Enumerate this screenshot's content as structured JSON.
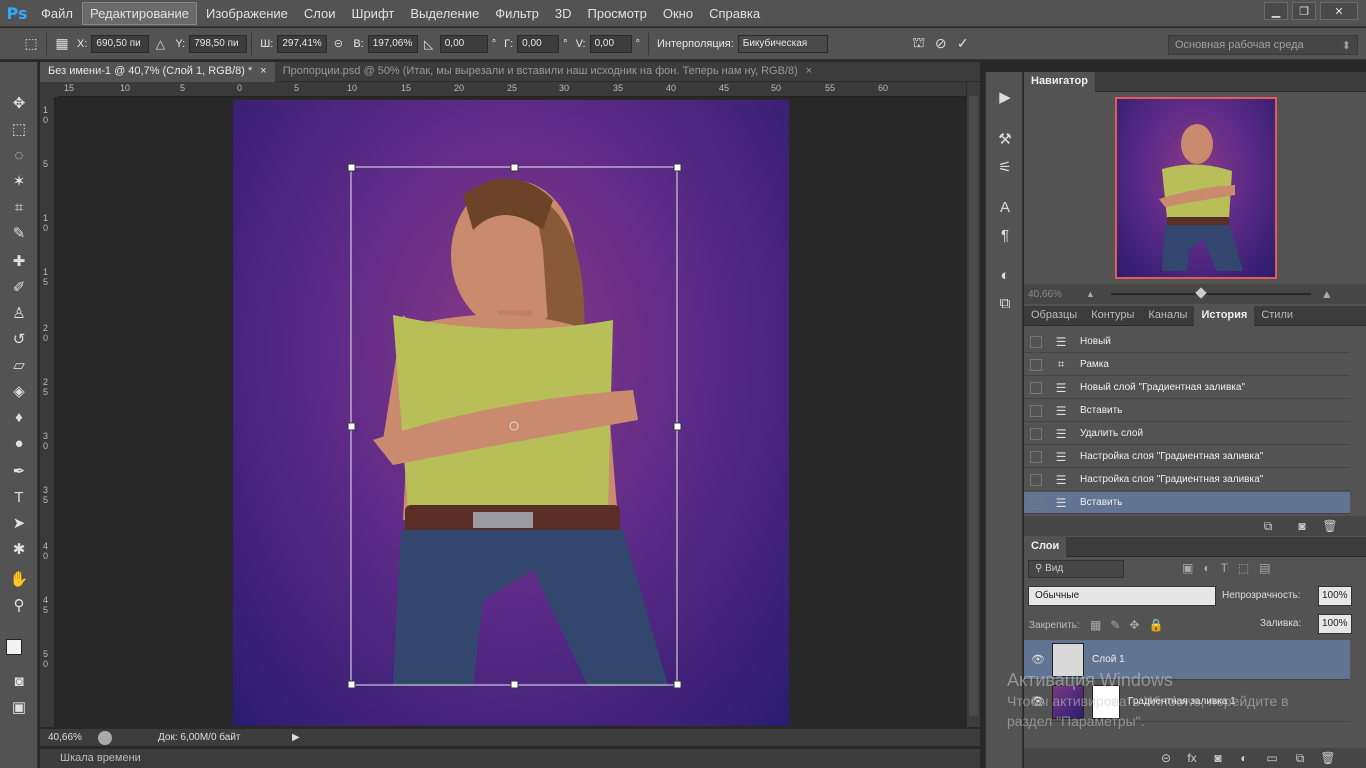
{
  "app": {
    "logo": "Ps"
  },
  "menu": [
    "Файл",
    "Редактирование",
    "Изображение",
    "Слои",
    "Шрифт",
    "Выделение",
    "Фильтр",
    "3D",
    "Просмотр",
    "Окно",
    "Справка"
  ],
  "menu_active_index": 1,
  "window_controls": {
    "minimize": "▁",
    "restore": "❐",
    "close": "✕"
  },
  "options": {
    "x_label": "X:",
    "x_value": "690,50 пи",
    "y_label": "Y:",
    "y_value": "798,50 пи",
    "w_label": "Ш:",
    "w_value": "297,41%",
    "h_label": "В:",
    "h_value": "197,06%",
    "angle_value": "0,00",
    "angle_unit": "°",
    "hskew_label": "Г:",
    "hskew_value": "0,00",
    "hskew_unit": "°",
    "vskew_label": "V:",
    "vskew_value": "0,00",
    "vskew_unit": "°",
    "interp_label": "Интерполяция:",
    "interp_value": "Бикубическая",
    "workspace": "Основная рабочая среда"
  },
  "tabs": [
    {
      "title": "Без имени-1 @ 40,7% (Слой 1, RGB/8) *",
      "close": "×",
      "active": true
    },
    {
      "title": "Пропорции.psd @ 50% (Итак, мы вырезали и вставили наш исходник на фон. Теперь нам ну, RGB/8)",
      "close": "×",
      "active": false
    }
  ],
  "ruler_top": [
    "15",
    "10",
    "5",
    "0",
    "5",
    "10",
    "15",
    "20",
    "25",
    "30",
    "35",
    "40",
    "45",
    "50",
    "55",
    "60"
  ],
  "ruler_left": [
    "1",
    "0",
    "5",
    "1",
    "0",
    "1",
    "5",
    "2",
    "0",
    "2",
    "5",
    "3",
    "0",
    "3",
    "5",
    "4",
    "0",
    "4",
    "5",
    "5",
    "0"
  ],
  "status": {
    "zoom": "40,66%",
    "doc": "Док: 6,00M/0 байт"
  },
  "timeline": "Шкала времени",
  "navigator": {
    "title": "Навигатор",
    "zoom": "40,66%"
  },
  "history_tabs": [
    "Образцы",
    "Контуры",
    "Каналы",
    "История",
    "Стили"
  ],
  "history_active": 3,
  "history": [
    {
      "label": "Новый",
      "icon": "document-icon"
    },
    {
      "label": "Рамка",
      "icon": "crop-icon"
    },
    {
      "label": "Новый слой \"Градиентная заливка\"",
      "icon": "document-icon"
    },
    {
      "label": "Вставить",
      "icon": "document-icon"
    },
    {
      "label": "Удалить слой",
      "icon": "document-icon"
    },
    {
      "label": "Настройка слоя \"Градиентная заливка\"",
      "icon": "document-icon"
    },
    {
      "label": "Настройка слоя \"Градиентная заливка\"",
      "icon": "document-icon"
    },
    {
      "label": "Вставить",
      "icon": "document-icon",
      "selected": true
    }
  ],
  "layers": {
    "title": "Слои",
    "filter": "Вид",
    "blend": "Обычные",
    "opacity_label": "Непрозрачность:",
    "opacity": "100%",
    "lock_label": "Закрепить:",
    "fill_label": "Заливка:",
    "fill": "100%",
    "items": [
      {
        "name": "Слой 1",
        "selected": true
      },
      {
        "name": "Градиентная заливка 1",
        "selected": false
      }
    ]
  },
  "watermark": {
    "line1": "Активация Windows",
    "line2": "Чтобы активировать Windows, перейдите в",
    "line3": "раздел \"Параметры\"."
  },
  "colors": {
    "accent": "#31a8ff",
    "selection": "#617593",
    "nav_frame": "#e65a55"
  }
}
